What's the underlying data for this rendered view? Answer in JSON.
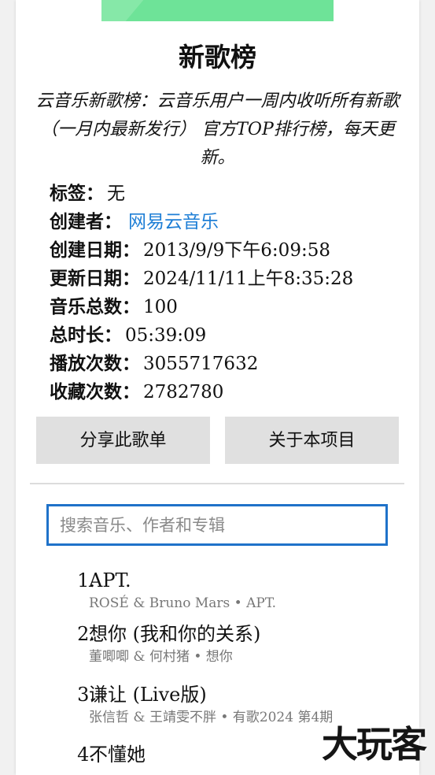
{
  "colors": {
    "accent": "#1f72c9",
    "link": "#1f7fd6",
    "cover_green": "#6ee398",
    "button_bg": "#e0e0e0"
  },
  "playlist": {
    "title": "新歌榜",
    "description": "云音乐新歌榜：云音乐用户一周内收听所有新歌（一月内最新发行） 官方TOP排行榜，每天更新。"
  },
  "meta": {
    "tags_label": "标签：",
    "tags_value": "无",
    "creator_label": "创建者：",
    "creator_value": "网易云音乐",
    "created_label": "创建日期：",
    "created_value": "2013/9/9下午6:09:58",
    "updated_label": "更新日期：",
    "updated_value": "2024/11/11上午8:35:28",
    "total_label": "音乐总数：",
    "total_value": "100",
    "duration_label": "总时长：",
    "duration_value": "05:39:09",
    "plays_label": "播放次数：",
    "plays_value": "3055717632",
    "favorites_label": "收藏次数：",
    "favorites_value": "2782780"
  },
  "actions": {
    "share_label": "分享此歌单",
    "about_label": "关于本项目"
  },
  "search": {
    "placeholder": "搜索音乐、作者和专辑"
  },
  "songs": [
    {
      "num": "1.",
      "title": "APT.",
      "sub": "ROSÉ & Bruno Mars • APT."
    },
    {
      "num": "2.",
      "title": "想你 (我和你的关系)",
      "sub": "董唧唧 & 何村猪 • 想你"
    },
    {
      "num": "3.",
      "title": "谦让 (Live版)",
      "sub": "张信哲 & 王靖雯不胖 • 有歌2024 第4期"
    },
    {
      "num": "4.",
      "title": "不懂她",
      "sub": ""
    }
  ],
  "watermark": "大玩客"
}
